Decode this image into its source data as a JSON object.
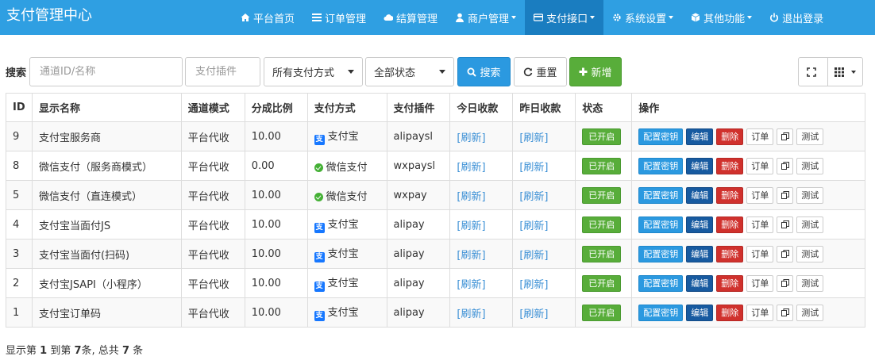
{
  "app": {
    "title": "支付管理中心"
  },
  "nav": [
    {
      "label": "平台首页",
      "icon": "home-icon",
      "dropdown": false,
      "active": false
    },
    {
      "label": "订单管理",
      "icon": "list-icon",
      "dropdown": false,
      "active": false
    },
    {
      "label": "结算管理",
      "icon": "cloud-icon",
      "dropdown": false,
      "active": false
    },
    {
      "label": "商户管理",
      "icon": "user-icon",
      "dropdown": true,
      "active": false
    },
    {
      "label": "支付接口",
      "icon": "credit-card-icon",
      "dropdown": true,
      "active": true
    },
    {
      "label": "系统设置",
      "icon": "gear-icon",
      "dropdown": true,
      "active": false
    },
    {
      "label": "其他功能",
      "icon": "cube-icon",
      "dropdown": true,
      "active": false
    },
    {
      "label": "退出登录",
      "icon": "power-icon",
      "dropdown": false,
      "active": false
    }
  ],
  "toolbar": {
    "search_label": "搜索",
    "channel_placeholder": "通道ID/名称",
    "plugin_placeholder": "支付插件",
    "paytype_value": "所有支付方式",
    "status_value": "全部状态",
    "search_btn": "搜索",
    "reset_btn": "重置",
    "add_btn": "新增"
  },
  "table": {
    "headers": [
      "ID",
      "显示名称",
      "通道模式",
      "分成比例",
      "支付方式",
      "支付插件",
      "今日收款",
      "昨日收款",
      "状态",
      "操作"
    ],
    "rows": [
      {
        "id": "9",
        "name": "支付宝服务商",
        "mode": "平台代收",
        "rate": "10.00",
        "paytype": "支付宝",
        "paytype_icon": "alipay-icon",
        "plugin": "alipaysl",
        "today": "[刷新]",
        "yesterday": "[刷新]",
        "status": "已开启"
      },
      {
        "id": "8",
        "name": "微信支付（服务商模式）",
        "mode": "平台代收",
        "rate": "0.00",
        "paytype": "微信支付",
        "paytype_icon": "wechat-icon",
        "plugin": "wxpaysl",
        "today": "[刷新]",
        "yesterday": "[刷新]",
        "status": "已开启"
      },
      {
        "id": "5",
        "name": "微信支付（直连模式）",
        "mode": "平台代收",
        "rate": "10.00",
        "paytype": "微信支付",
        "paytype_icon": "wechat-icon",
        "plugin": "wxpay",
        "today": "[刷新]",
        "yesterday": "[刷新]",
        "status": "已开启"
      },
      {
        "id": "4",
        "name": "支付宝当面付JS",
        "mode": "平台代收",
        "rate": "10.00",
        "paytype": "支付宝",
        "paytype_icon": "alipay-icon",
        "plugin": "alipay",
        "today": "[刷新]",
        "yesterday": "[刷新]",
        "status": "已开启"
      },
      {
        "id": "3",
        "name": "支付宝当面付(扫码)",
        "mode": "平台代收",
        "rate": "10.00",
        "paytype": "支付宝",
        "paytype_icon": "alipay-icon",
        "plugin": "alipay",
        "today": "[刷新]",
        "yesterday": "[刷新]",
        "status": "已开启"
      },
      {
        "id": "2",
        "name": "支付宝JSAPI（小程序）",
        "mode": "平台代收",
        "rate": "10.00",
        "paytype": "支付宝",
        "paytype_icon": "alipay-icon",
        "plugin": "alipay",
        "today": "[刷新]",
        "yesterday": "[刷新]",
        "status": "已开启"
      },
      {
        "id": "1",
        "name": "支付宝订单码",
        "mode": "平台代收",
        "rate": "10.00",
        "paytype": "支付宝",
        "paytype_icon": "alipay-icon",
        "plugin": "alipay",
        "today": "[刷新]",
        "yesterday": "[刷新]",
        "status": "已开启"
      }
    ],
    "ops": {
      "key": "配置密钥",
      "edit": "编辑",
      "delete": "删除",
      "order": "订单",
      "test": "测试"
    }
  },
  "pagination": {
    "prefix": "显示第",
    "from": "1",
    "mid1": "到第",
    "to": "7",
    "mid2": "条, 总共",
    "total": "7",
    "suffix": "条"
  },
  "colors": {
    "navbar": "#2f9fe2",
    "nav_active": "#1a7dc0",
    "primary": "#2b99e0",
    "success": "#58ad3a",
    "danger": "#d0312d",
    "edit": "#175aa0",
    "link": "#3a8fd5"
  }
}
